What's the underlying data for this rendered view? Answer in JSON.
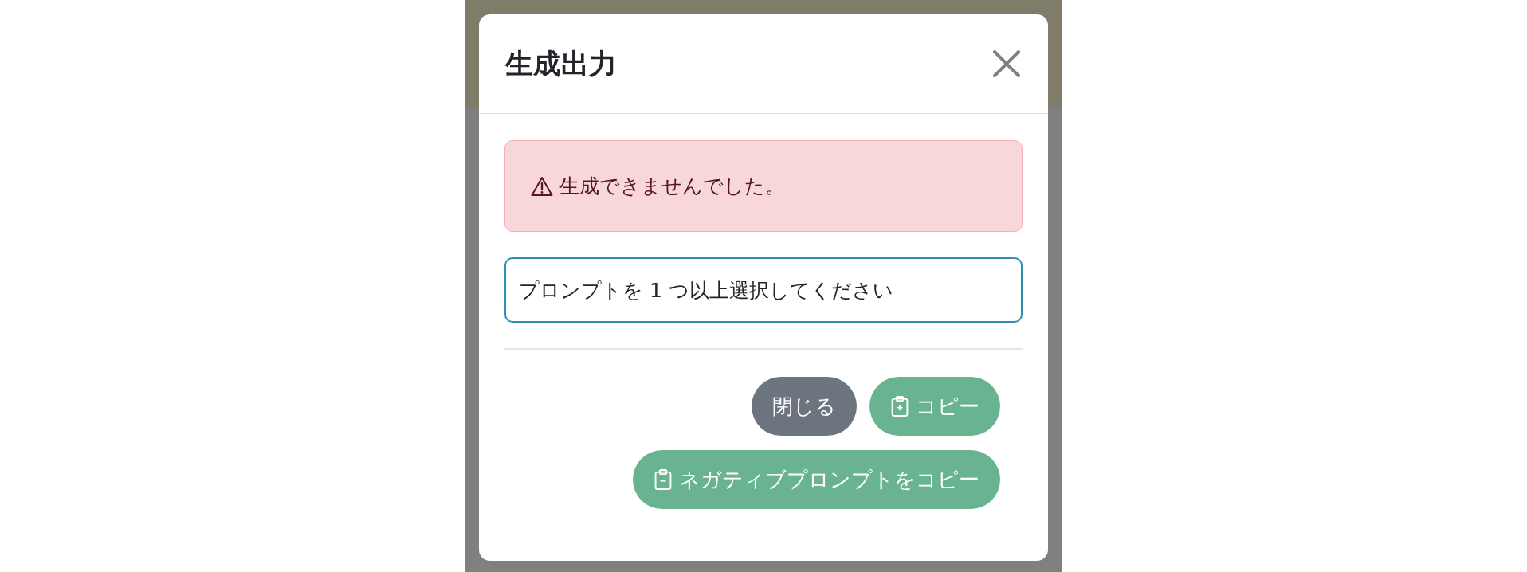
{
  "modal": {
    "title": "生成出力",
    "alert": {
      "text": "生成できませんでした。"
    },
    "output": {
      "value": "プロンプトを 1 つ以上選択してください"
    },
    "buttons": [
      {
        "label": "閉じる",
        "kind": "close"
      },
      {
        "label": "コピー",
        "kind": "copy"
      },
      {
        "label": "ネガティブプロンプトをコピー",
        "kind": "copy-negative"
      }
    ]
  }
}
